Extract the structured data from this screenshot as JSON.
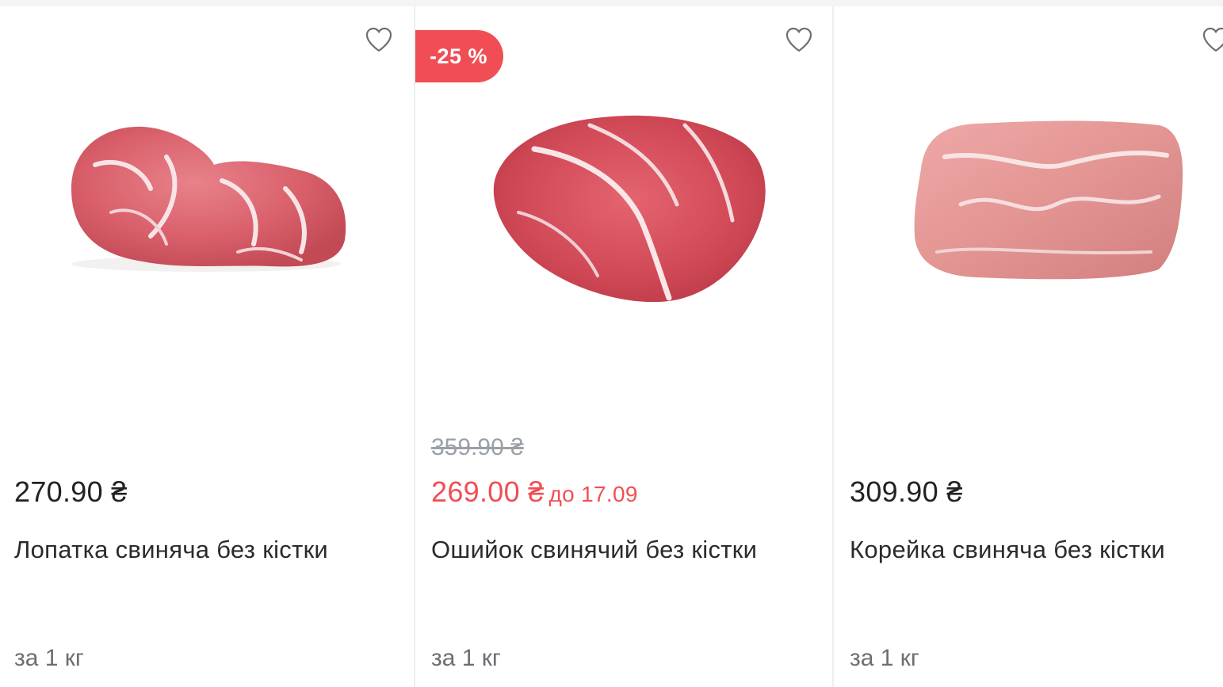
{
  "colors": {
    "accent": "#f04e54",
    "text": "#222222",
    "muted": "#9aa0a6",
    "divider": "#eceef0"
  },
  "products": [
    {
      "price": "270.90 ₴",
      "name": "Лопатка свиняча без кістки",
      "unit": "за 1 кг",
      "image": "pork-shoulder-image",
      "icon": "heart-icon"
    },
    {
      "badge": "-25 %",
      "old_price": "359.90 ₴",
      "price": "269.00 ₴",
      "until": "до 17.09",
      "name": "Ошийок свинячий без кістки",
      "unit": "за 1 кг",
      "image": "pork-neck-image",
      "icon": "heart-icon"
    },
    {
      "price": "309.90 ₴",
      "name": "Корейка свиняча без кістки",
      "unit": "за 1 кг",
      "image": "pork-loin-image",
      "icon": "heart-icon"
    }
  ]
}
